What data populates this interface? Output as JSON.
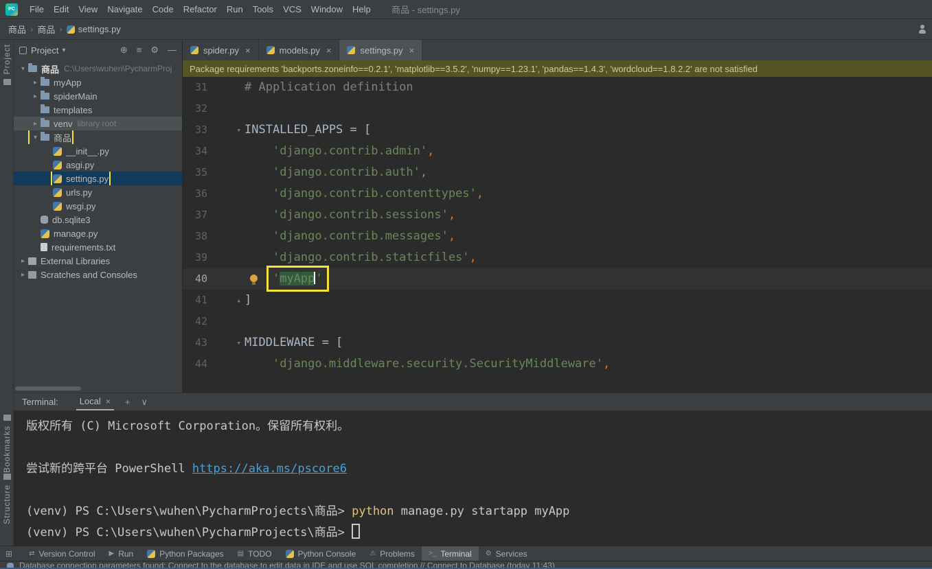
{
  "colors": {
    "annotation_yellow": "#F2E23A",
    "selection_blue": "#113A5C",
    "string_green": "#6A8759",
    "banner_olive": "#555427",
    "link_blue": "#4B9FD5"
  },
  "title_bar": {
    "logo": "PC",
    "menus": [
      "File",
      "Edit",
      "View",
      "Navigate",
      "Code",
      "Refactor",
      "Run",
      "Tools",
      "VCS",
      "Window",
      "Help"
    ],
    "window_title": "商品 - settings.py"
  },
  "breadcrumb": {
    "items": [
      "商品",
      "商品",
      "settings.py"
    ]
  },
  "left_stripe": {
    "project": "Project",
    "bookmarks": "Bookmarks",
    "structure": "Structure"
  },
  "project_panel": {
    "title": "Project",
    "header_icons": [
      "locate-icon",
      "collapse-all-icon",
      "settings-icon",
      "hide-icon"
    ],
    "tree": [
      {
        "label": "商品",
        "hint": "C:\\Users\\wuhen\\PycharmProj",
        "icon": "folder",
        "level": 0,
        "chevron": "down",
        "bold": true
      },
      {
        "label": "myApp",
        "icon": "folder",
        "level": 1,
        "chevron": "right"
      },
      {
        "label": "spiderMain",
        "icon": "folder",
        "level": 1,
        "chevron": "right"
      },
      {
        "label": "templates",
        "icon": "folder",
        "level": 1
      },
      {
        "label": "venv",
        "hint": "library root",
        "icon": "folder",
        "level": 1,
        "chevron": "right",
        "row_highlight": true
      },
      {
        "label": "商品",
        "icon": "folder",
        "level": 1,
        "chevron": "down",
        "annotation_box": true
      },
      {
        "label": "__init__.py",
        "icon": "python",
        "level": 2
      },
      {
        "label": "asgi.py",
        "icon": "python",
        "level": 2
      },
      {
        "label": "settings.py",
        "icon": "python",
        "level": 2,
        "selected": true,
        "annotation_box": true
      },
      {
        "label": "urls.py",
        "icon": "python",
        "level": 2
      },
      {
        "label": "wsgi.py",
        "icon": "python",
        "level": 2
      },
      {
        "label": "db.sqlite3",
        "icon": "database",
        "level": 1
      },
      {
        "label": "manage.py",
        "icon": "python",
        "level": 1
      },
      {
        "label": "requirements.txt",
        "icon": "text",
        "level": 1
      },
      {
        "label": "External Libraries",
        "icon": "libraries",
        "level": 0,
        "chevron": "right"
      },
      {
        "label": "Scratches and Consoles",
        "icon": "scratches",
        "level": 0,
        "chevron": "right"
      }
    ]
  },
  "editor": {
    "tabs": [
      {
        "label": "spider.py",
        "active": false
      },
      {
        "label": "models.py",
        "active": false
      },
      {
        "label": "settings.py",
        "active": true
      }
    ],
    "banner": "Package requirements 'backports.zoneinfo==0.2.1', 'matplotlib==3.5.2', 'numpy==1.23.1', 'pandas==1.4.3', 'wordcloud==1.8.2.2' are not satisfied",
    "lines": [
      {
        "num": "31",
        "tokens": [
          {
            "t": "# Application definition",
            "c": "comment"
          }
        ]
      },
      {
        "num": "32",
        "tokens": []
      },
      {
        "num": "33",
        "fold": "open",
        "tokens": [
          {
            "t": "INSTALLED_APPS = [",
            "c": "plain"
          }
        ]
      },
      {
        "num": "34",
        "tokens": [
          {
            "t": "    ",
            "c": "plain"
          },
          {
            "t": "'django.contrib.admin'",
            "c": "string"
          },
          {
            "t": ",",
            "c": "comma"
          }
        ]
      },
      {
        "num": "35",
        "tokens": [
          {
            "t": "    ",
            "c": "plain"
          },
          {
            "t": "'django.contrib.auth'",
            "c": "string"
          },
          {
            "t": ",",
            "c": "comma"
          }
        ]
      },
      {
        "num": "36",
        "tokens": [
          {
            "t": "    ",
            "c": "plain"
          },
          {
            "t": "'django.contrib.contenttypes'",
            "c": "string"
          },
          {
            "t": ",",
            "c": "comma"
          }
        ]
      },
      {
        "num": "37",
        "tokens": [
          {
            "t": "    ",
            "c": "plain"
          },
          {
            "t": "'django.contrib.sessions'",
            "c": "string"
          },
          {
            "t": ",",
            "c": "comma"
          }
        ]
      },
      {
        "num": "38",
        "tokens": [
          {
            "t": "    ",
            "c": "plain"
          },
          {
            "t": "'django.contrib.messages'",
            "c": "string"
          },
          {
            "t": ",",
            "c": "comma"
          }
        ]
      },
      {
        "num": "39",
        "tokens": [
          {
            "t": "    ",
            "c": "plain"
          },
          {
            "t": "'django.contrib.staticfiles'",
            "c": "string"
          },
          {
            "t": ",",
            "c": "comma"
          }
        ]
      },
      {
        "num": "40",
        "caret_line": true,
        "bulb": true,
        "tokens": [
          {
            "t": "    ",
            "c": "plain"
          },
          {
            "t": "'",
            "c": "string",
            "box": true
          },
          {
            "t": "myApp",
            "c": "string",
            "box": true,
            "selected": true,
            "caret_after": true
          },
          {
            "t": "'",
            "c": "string",
            "box": true
          }
        ]
      },
      {
        "num": "41",
        "fold": "close",
        "tokens": [
          {
            "t": "]",
            "c": "plain"
          }
        ]
      },
      {
        "num": "42",
        "tokens": []
      },
      {
        "num": "43",
        "fold": "open",
        "tokens": [
          {
            "t": "MIDDLEWARE = [",
            "c": "plain"
          }
        ]
      },
      {
        "num": "44",
        "tokens": [
          {
            "t": "    ",
            "c": "plain"
          },
          {
            "t": "'django.middleware.security.SecurityMiddleware'",
            "c": "string"
          },
          {
            "t": ",",
            "c": "comma"
          }
        ]
      }
    ]
  },
  "terminal": {
    "label": "Terminal:",
    "tab_label": "Local",
    "header_icons": [
      "add-icon",
      "chevron-down-icon"
    ],
    "lines": [
      {
        "tokens": [
          {
            "t": "版权所有 (C) Microsoft Corporation。保留所有权利。",
            "c": "plain"
          }
        ]
      },
      {
        "tokens": []
      },
      {
        "tokens": [
          {
            "t": "尝试新的跨平台 PowerShell ",
            "c": "plain"
          },
          {
            "t": "https://aka.ms/pscore6",
            "c": "link"
          }
        ]
      },
      {
        "tokens": []
      },
      {
        "tokens": [
          {
            "t": "(venv) PS C:\\Users\\wuhen\\PycharmProjects\\商品> ",
            "c": "plain"
          },
          {
            "t": "python",
            "c": "command"
          },
          {
            "t": " manage.py startapp myApp",
            "c": "plain"
          }
        ]
      },
      {
        "tokens": [
          {
            "t": "(venv) PS C:\\Users\\wuhen\\PycharmProjects\\商品> ",
            "c": "plain"
          }
        ],
        "cursor": true
      }
    ]
  },
  "bottom_bar": {
    "buttons": [
      {
        "label": "Version Control",
        "icon": "version-control"
      },
      {
        "label": "Run",
        "icon": "run"
      },
      {
        "label": "Python Packages",
        "icon": "python"
      },
      {
        "label": "TODO",
        "icon": "todo"
      },
      {
        "label": "Python Console",
        "icon": "python"
      },
      {
        "label": "Problems",
        "icon": "problems"
      },
      {
        "label": "Terminal",
        "icon": "terminal",
        "active": true
      },
      {
        "label": "Services",
        "icon": "services"
      }
    ]
  },
  "status_bar": {
    "message": "Database connection parameters found: Connect to the database to edit data in IDE and use SQL completion // Connect to Database (today 11:43)"
  }
}
